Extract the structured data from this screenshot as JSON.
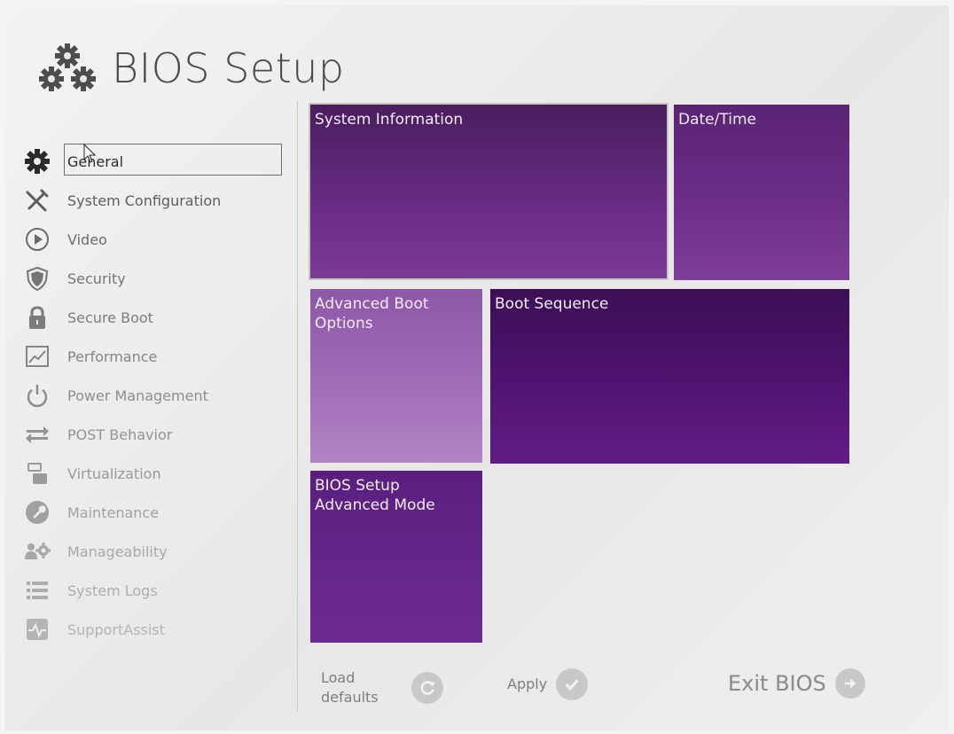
{
  "app": {
    "title": "BIOS Setup",
    "logo_icon": "gears-icon"
  },
  "sidebar": {
    "items": [
      {
        "label": "General",
        "icon": "gear-icon",
        "selected": true,
        "color": "#2b2b2b"
      },
      {
        "label": "System Configuration",
        "icon": "tools-icon",
        "color": "#5e5e5e"
      },
      {
        "label": "Video",
        "icon": "play-circle-icon",
        "color": "#6c6c6c"
      },
      {
        "label": "Security",
        "icon": "shield-icon",
        "color": "#757575"
      },
      {
        "label": "Secure Boot",
        "icon": "lock-icon",
        "color": "#7c7c7c"
      },
      {
        "label": "Performance",
        "icon": "chart-icon",
        "color": "#858585"
      },
      {
        "label": "Power Management",
        "icon": "power-icon",
        "color": "#8d8d8d"
      },
      {
        "label": "POST Behavior",
        "icon": "arrows-icon",
        "color": "#949494"
      },
      {
        "label": "Virtualization",
        "icon": "server-icon",
        "color": "#9a9a9a"
      },
      {
        "label": "Maintenance",
        "icon": "wrench-icon",
        "color": "#a1a1a1"
      },
      {
        "label": "Manageability",
        "icon": "users-gear-icon",
        "color": "#a8a8a8"
      },
      {
        "label": "System Logs",
        "icon": "list-icon",
        "color": "#aeaeae"
      },
      {
        "label": "SupportAssist",
        "icon": "heartbeat-icon",
        "color": "#b4b4b4"
      }
    ]
  },
  "tiles": {
    "system_information": "System Information",
    "date_time": "Date/Time",
    "advanced_boot_options": "Advanced Boot Options",
    "boot_sequence": "Boot Sequence",
    "advanced_mode": "BIOS Setup Advanced Mode"
  },
  "actions": {
    "load_defaults": "Load defaults",
    "apply": "Apply",
    "exit": "Exit BIOS"
  }
}
